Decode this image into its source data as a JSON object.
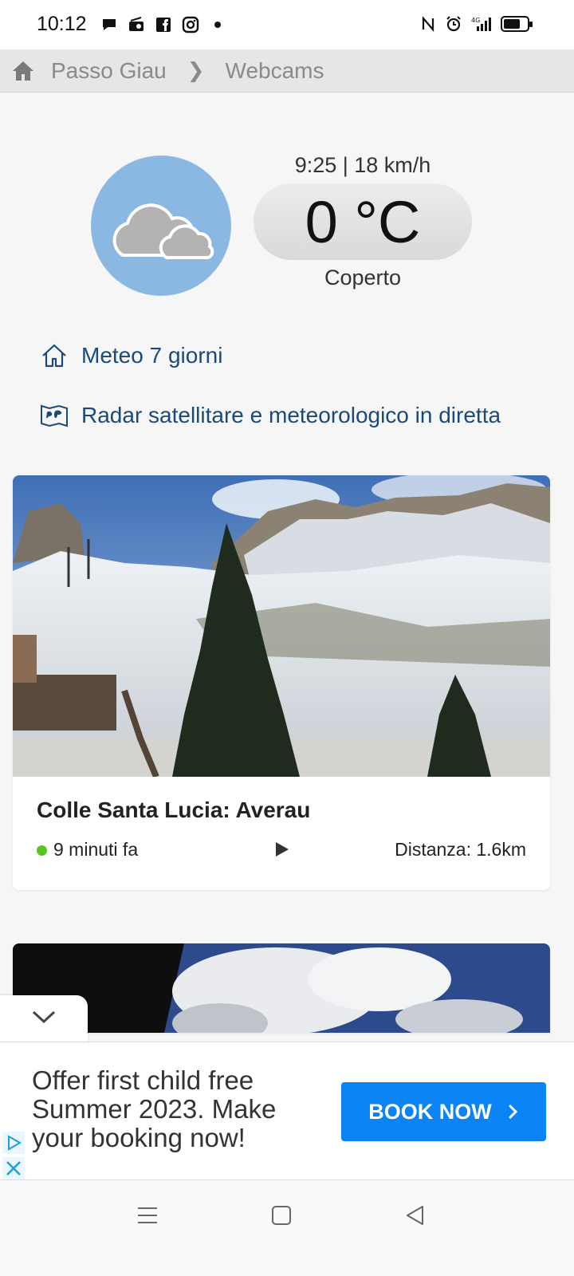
{
  "status_bar": {
    "time": "10:12",
    "left_icons": [
      "chat-icon",
      "radio-icon",
      "facebook-icon",
      "instagram-icon",
      "dot-icon"
    ],
    "right_icons": [
      "nfc-icon",
      "alarm-icon",
      "signal-4g-icon",
      "battery-icon"
    ],
    "network": "4G"
  },
  "breadcrumb": {
    "home_icon": "home-icon",
    "items": [
      "Passo Giau",
      "Webcams"
    ],
    "separator": "❯"
  },
  "weather": {
    "time_wind": "9:25 | 18 km/h",
    "temperature": "0 °C",
    "condition": "Coperto",
    "icon": "cloud-icon",
    "circle_color": "#8bb8e3"
  },
  "links": [
    {
      "label": "Meteo 7 giorni",
      "icon": "house-outline-icon"
    },
    {
      "label": "Radar satellitare e meteorologico in diretta",
      "icon": "world-map-icon"
    }
  ],
  "webcams": [
    {
      "title": "Colle Santa Lucia: Averau",
      "ago": "9 minuti fa",
      "distance": "Distanza: 1.6km",
      "status_color": "#57c41f"
    }
  ],
  "ad": {
    "text": "Offer first child free Summer 2023. Make your booking now!",
    "button_label": "BOOK NOW",
    "button_color": "#0a84f5"
  },
  "nav": {
    "buttons": [
      "menu-icon",
      "home-square-icon",
      "back-triangle-icon"
    ]
  }
}
